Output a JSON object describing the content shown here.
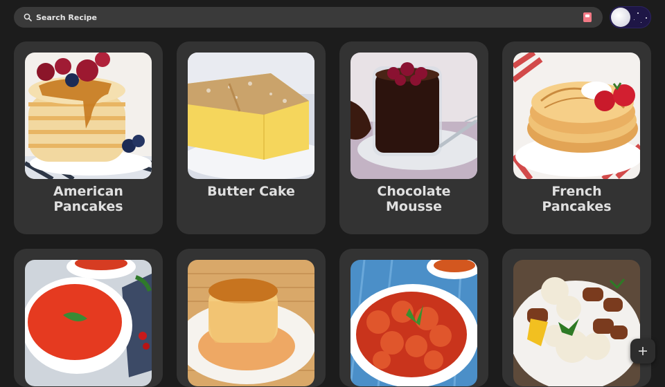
{
  "search": {
    "placeholder": "Search Recipe",
    "icon": "search-icon",
    "trailing_icon": "recipe-book-icon"
  },
  "theme_toggle": {
    "mode": "dark",
    "icon": "moon-icon"
  },
  "recipes": [
    {
      "title": "American\nPancakes"
    },
    {
      "title": "Butter Cake"
    },
    {
      "title": "Chocolate\nMousse"
    },
    {
      "title": "French\nPancakes"
    },
    {
      "title": ""
    },
    {
      "title": ""
    },
    {
      "title": ""
    },
    {
      "title": ""
    }
  ],
  "fab": {
    "icon": "plus-icon"
  },
  "colors": {
    "background": "#1c1c1c",
    "card": "#333333",
    "search_bar": "#3a3a3a",
    "title_text": "#e0e0e0",
    "accent": "#f37a86"
  }
}
